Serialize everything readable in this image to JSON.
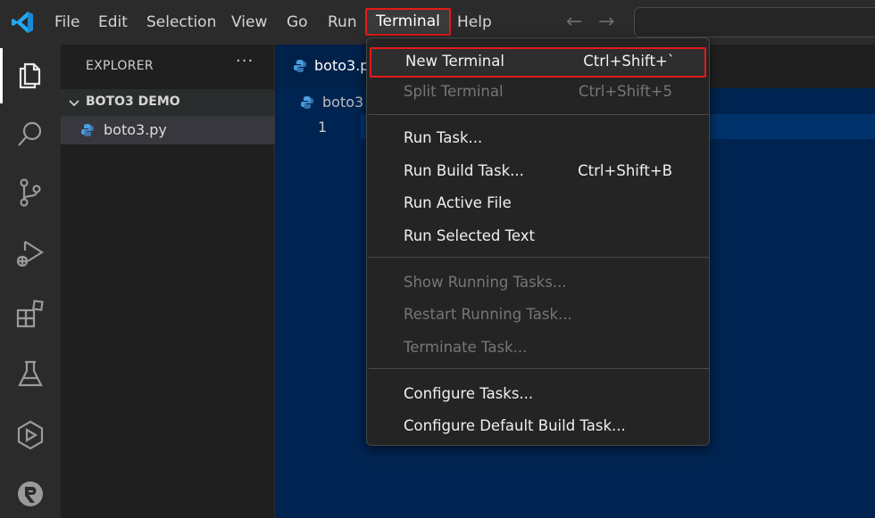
{
  "menubar": {
    "items": [
      "File",
      "Edit",
      "Selection",
      "View",
      "Go",
      "Run",
      "Terminal",
      "Help"
    ],
    "back_arrow": "←",
    "forward_arrow": "→"
  },
  "sidebar": {
    "title": "EXPLORER",
    "more": "···",
    "folder": "BOTO3 DEMO",
    "file": "boto3.py"
  },
  "editor": {
    "tab_label": "boto3.p",
    "breadcrumb": "boto3",
    "line_number": "1"
  },
  "terminal_menu": {
    "group1": [
      {
        "label": "New Terminal",
        "shortcut": "Ctrl+Shift+`",
        "enabled": true
      },
      {
        "label": "Split Terminal",
        "shortcut": "Ctrl+Shift+5",
        "enabled": false
      }
    ],
    "group2": [
      {
        "label": "Run Task...",
        "shortcut": "",
        "enabled": true
      },
      {
        "label": "Run Build Task...",
        "shortcut": "Ctrl+Shift+B",
        "enabled": true
      },
      {
        "label": "Run Active File",
        "shortcut": "",
        "enabled": true
      },
      {
        "label": "Run Selected Text",
        "shortcut": "",
        "enabled": true
      }
    ],
    "group3": [
      {
        "label": "Show Running Tasks...",
        "shortcut": "",
        "enabled": false
      },
      {
        "label": "Restart Running Task...",
        "shortcut": "",
        "enabled": false
      },
      {
        "label": "Terminate Task...",
        "shortcut": "",
        "enabled": false
      }
    ],
    "group4": [
      {
        "label": "Configure Tasks...",
        "shortcut": "",
        "enabled": true
      },
      {
        "label": "Configure Default Build Task...",
        "shortcut": "",
        "enabled": true
      }
    ]
  },
  "colors": {
    "highlight_border": "#e31a1a",
    "editor_background": "#002451",
    "brand_blue": "#23a9f2"
  },
  "icons": {
    "logo": "vscode-logo-icon",
    "activity": [
      "explorer-icon",
      "search-icon",
      "source-control-icon",
      "run-debug-icon",
      "extensions-icon",
      "testing-icon",
      "remote-explorer-icon",
      "r-icon"
    ]
  }
}
